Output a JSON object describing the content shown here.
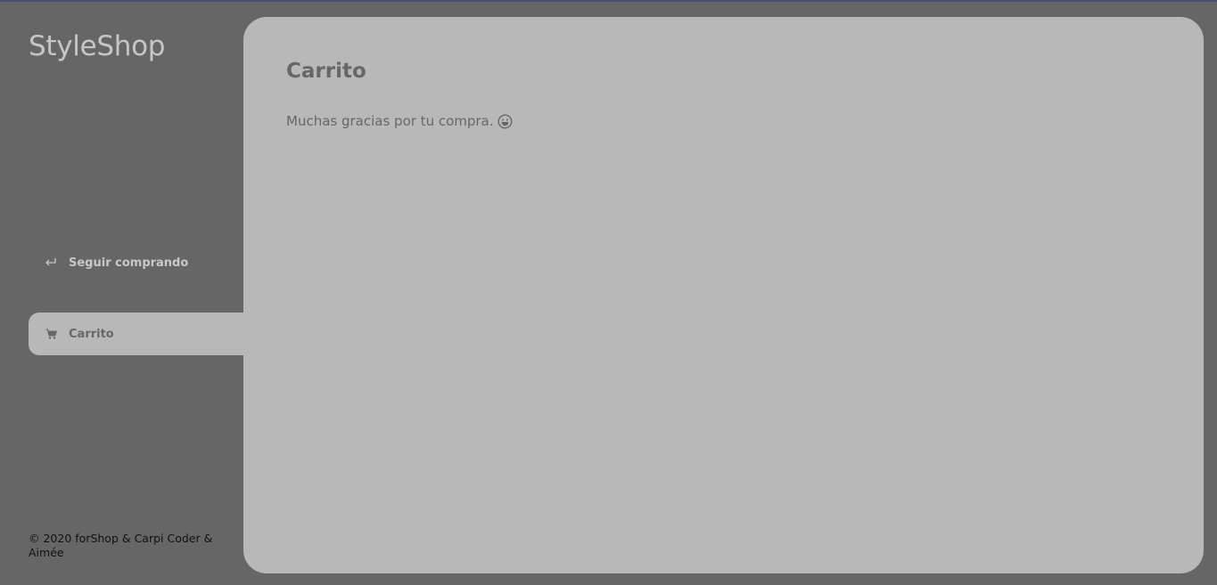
{
  "app": {
    "brand": "StyleShop"
  },
  "sidebar": {
    "items": [
      {
        "label": "Seguir comprando",
        "icon": "return-arrow-icon",
        "active": false
      },
      {
        "label": "Carrito",
        "icon": "cart-icon",
        "active": true
      }
    ],
    "footer": "© 2020 forShop & Carpi Coder & Aimée"
  },
  "main": {
    "title": "Carrito",
    "message": "Muchas gracias por tu compra.",
    "message_icon": "grinning-face-icon"
  },
  "colors": {
    "background": "#666666",
    "panel": "#b8b8b8",
    "text_dark": "#676767",
    "text_light": "#c8c8c8"
  }
}
